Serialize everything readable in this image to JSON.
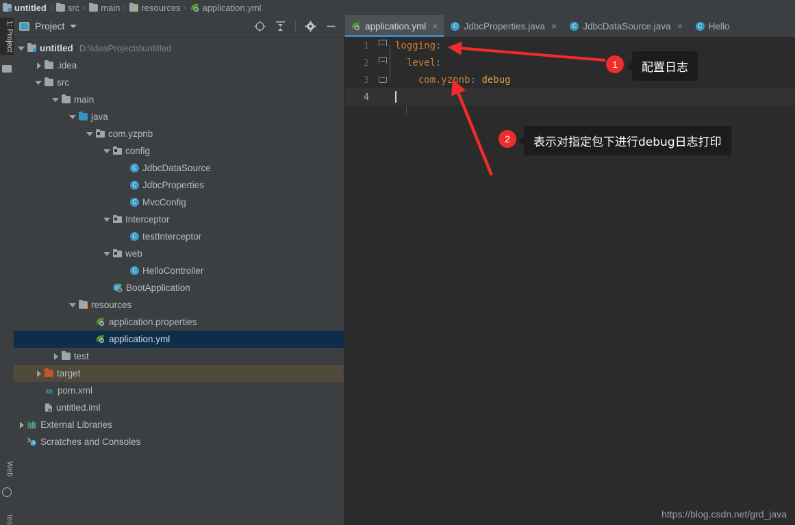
{
  "breadcrumb": {
    "separator": "›",
    "items": [
      {
        "label": "untitled",
        "icon": "module-folder-icon"
      },
      {
        "label": "src",
        "icon": "folder-icon"
      },
      {
        "label": "main",
        "icon": "folder-icon"
      },
      {
        "label": "resources",
        "icon": "resources-folder-icon"
      },
      {
        "label": "application.yml",
        "icon": "spring-yaml-icon"
      }
    ]
  },
  "toolstrip": {
    "buttons": [
      {
        "label": "1: Project",
        "active": true
      },
      {
        "label": "Web",
        "active": false
      },
      {
        "label": "tes",
        "active": false
      }
    ]
  },
  "project_panel": {
    "title": "Project",
    "actions": [
      {
        "name": "select-opened-file-icon"
      },
      {
        "name": "collapse-all-icon"
      },
      {
        "name": "settings-gear-icon"
      },
      {
        "name": "hide-panel-icon"
      }
    ],
    "tree": [
      {
        "label": "untitled",
        "sub": "D:\\IdeaProjects\\untitled",
        "indent": 0,
        "arrow": "open",
        "icon": "module-folder-icon",
        "bold": true
      },
      {
        "label": ".idea",
        "sub": "",
        "indent": 1,
        "arrow": "closed",
        "icon": "folder-icon"
      },
      {
        "label": "src",
        "sub": "",
        "indent": 1,
        "arrow": "open",
        "icon": "folder-icon"
      },
      {
        "label": "main",
        "sub": "",
        "indent": 2,
        "arrow": "open",
        "icon": "folder-icon"
      },
      {
        "label": "java",
        "sub": "",
        "indent": 3,
        "arrow": "open",
        "icon": "source-folder-icon"
      },
      {
        "label": "com.yzpnb",
        "sub": "",
        "indent": 4,
        "arrow": "open",
        "icon": "package-icon"
      },
      {
        "label": "config",
        "sub": "",
        "indent": 5,
        "arrow": "open",
        "icon": "package-icon"
      },
      {
        "label": "JdbcDataSource",
        "sub": "",
        "indent": 6,
        "arrow": "none",
        "icon": "java-class-icon"
      },
      {
        "label": "JdbcProperties",
        "sub": "",
        "indent": 6,
        "arrow": "none",
        "icon": "java-class-icon"
      },
      {
        "label": "MvcConfig",
        "sub": "",
        "indent": 6,
        "arrow": "none",
        "icon": "java-class-icon"
      },
      {
        "label": "Interceptor",
        "sub": "",
        "indent": 5,
        "arrow": "open",
        "icon": "package-icon"
      },
      {
        "label": "testInterceptor",
        "sub": "",
        "indent": 6,
        "arrow": "none",
        "icon": "java-class-icon"
      },
      {
        "label": "web",
        "sub": "",
        "indent": 5,
        "arrow": "open",
        "icon": "package-icon"
      },
      {
        "label": "HelloController",
        "sub": "",
        "indent": 6,
        "arrow": "none",
        "icon": "java-class-icon"
      },
      {
        "label": "BootApplication",
        "sub": "",
        "indent": 5,
        "arrow": "none",
        "icon": "spring-boot-class-icon"
      },
      {
        "label": "resources",
        "sub": "",
        "indent": 3,
        "arrow": "open",
        "icon": "resources-folder-icon"
      },
      {
        "label": "application.properties",
        "sub": "",
        "indent": 4,
        "arrow": "none",
        "icon": "spring-properties-icon"
      },
      {
        "label": "application.yml",
        "sub": "",
        "indent": 4,
        "arrow": "none",
        "icon": "spring-yaml-icon",
        "selected": true
      },
      {
        "label": "test",
        "sub": "",
        "indent": 2,
        "arrow": "closed",
        "icon": "folder-icon"
      },
      {
        "label": "target",
        "sub": "",
        "indent": 1,
        "arrow": "closed",
        "icon": "excluded-folder-icon",
        "excluded": true
      },
      {
        "label": "pom.xml",
        "sub": "",
        "indent": 1,
        "arrow": "none",
        "icon": "maven-icon"
      },
      {
        "label": "untitled.iml",
        "sub": "",
        "indent": 1,
        "arrow": "none",
        "icon": "iml-icon"
      },
      {
        "label": "External Libraries",
        "sub": "",
        "indent": 0,
        "arrow": "closed",
        "icon": "libraries-icon"
      },
      {
        "label": "Scratches and Consoles",
        "sub": "",
        "indent": 0,
        "arrow": "none",
        "icon": "scratches-icon"
      }
    ]
  },
  "editor": {
    "tabs": [
      {
        "label": "application.yml",
        "icon": "spring-yaml-icon",
        "active": true,
        "close": "×"
      },
      {
        "label": "JdbcProperties.java",
        "icon": "java-class-icon",
        "active": false,
        "close": "×"
      },
      {
        "label": "JdbcDataSource.java",
        "icon": "java-class-icon",
        "active": false,
        "close": "×"
      },
      {
        "label": "Hello",
        "icon": "java-class-icon",
        "active": false,
        "close": ""
      }
    ],
    "lines": [
      {
        "no": "1",
        "fold": "top",
        "indent": 0,
        "tokens": [
          {
            "t": "logging",
            "c": "key"
          },
          {
            "t": ":",
            "c": "colon"
          }
        ]
      },
      {
        "no": "2",
        "fold": "mid",
        "indent": 1,
        "tokens": [
          {
            "t": "  ",
            "c": "plain"
          },
          {
            "t": "level",
            "c": "key"
          },
          {
            "t": ":",
            "c": "colon"
          }
        ]
      },
      {
        "no": "3",
        "fold": "end",
        "indent": 2,
        "tokens": [
          {
            "t": "    ",
            "c": "plain"
          },
          {
            "t": "com.yzpnb",
            "c": "key"
          },
          {
            "t": ":",
            "c": "colon"
          },
          {
            "t": " debug",
            "c": "val"
          }
        ]
      },
      {
        "no": "4",
        "fold": "none",
        "indent": 0,
        "current": true,
        "caret": true,
        "tokens": []
      }
    ]
  },
  "annotations": [
    {
      "number": "1",
      "text": "配置日志"
    },
    {
      "number": "2",
      "text": "表示对指定包下进行debug日志打印"
    }
  ],
  "watermark": "https://blog.csdn.net/grd_java",
  "colors": {
    "panel_bg": "#3c3f41",
    "editor_bg": "#2b2b2b",
    "selection": "#0d2d4b",
    "excluded": "#4f4a3b",
    "accent": "#3d86c9",
    "annotation_red": "#ef2d2d",
    "yaml_key": "#c87f34",
    "yaml_value": "#d1a24a",
    "yaml_colon": "#6a9fd4"
  }
}
